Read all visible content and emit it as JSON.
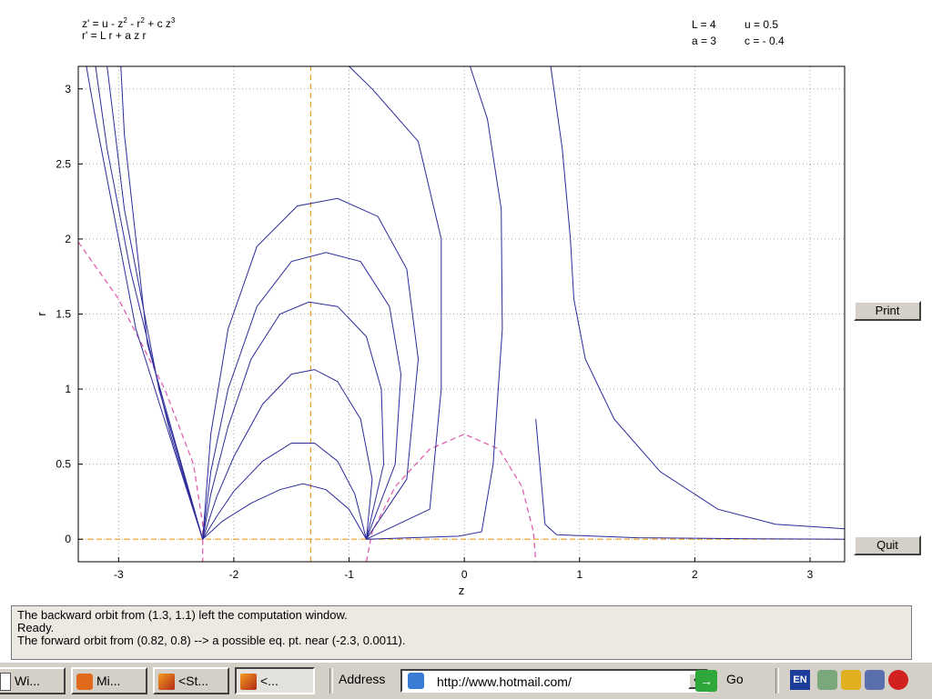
{
  "equations": {
    "z_prefix": "z' = u - z",
    "z_mid": " - r",
    "z_suffix": " + c z",
    "sup_two_a": "2",
    "sup_two_b": "2",
    "sup_three": "3",
    "r_eq": "r' = L r + a z r"
  },
  "params": {
    "L": "L = 4",
    "u": "u = 0.5",
    "a": "a = 3",
    "c": "c = - 0.4"
  },
  "buttons": {
    "print": "Print",
    "quit": "Quit"
  },
  "status_lines": [
    "The backward orbit from (1.3, 1.1) left the computation window.",
    "Ready.",
    "The forward orbit from (0.82, 0.8) --> a possible eq. pt. near (-2.3, 0.0011)."
  ],
  "taskbar": {
    "tasks": [
      "Wi...",
      "Mi...",
      "<St...",
      "<..."
    ],
    "address_label": "Address",
    "address_value": "http://www.hotmail.com/",
    "go_label": "Go",
    "lang_badge": "EN"
  },
  "colors": {
    "orbit": "#2b2b9a",
    "nullcline_z": "#e060b0",
    "nullcline_r": "#f0a020",
    "grid": "#a0a0a0"
  },
  "chart_data": {
    "type": "line",
    "xlabel": "z",
    "ylabel": "r",
    "xlim": [
      -3.35,
      3.3
    ],
    "ylim": [
      -0.15,
      3.15
    ],
    "x_ticks": [
      -3,
      -2,
      -1,
      0,
      1,
      2,
      3
    ],
    "y_ticks": [
      0,
      0.5,
      1,
      1.5,
      2,
      2.5,
      3
    ],
    "x_tick_labels": [
      "-3",
      "-2",
      "-1",
      "0",
      "1",
      "2",
      "3"
    ],
    "y_tick_labels": [
      "0",
      "0.5",
      "1",
      "1.5",
      "2",
      "2.5",
      "3"
    ],
    "grid": true,
    "orbits": [
      [
        [
          -0.85,
          0
        ],
        [
          -1.0,
          0.2
        ],
        [
          -1.2,
          0.33
        ],
        [
          -1.4,
          0.37
        ],
        [
          -1.6,
          0.33
        ],
        [
          -1.85,
          0.24
        ],
        [
          -2.1,
          0.12
        ],
        [
          -2.27,
          0
        ]
      ],
      [
        [
          -0.85,
          0
        ],
        [
          -0.95,
          0.3
        ],
        [
          -1.1,
          0.52
        ],
        [
          -1.3,
          0.64
        ],
        [
          -1.5,
          0.64
        ],
        [
          -1.75,
          0.52
        ],
        [
          -2.0,
          0.32
        ],
        [
          -2.15,
          0.15
        ],
        [
          -2.27,
          0
        ]
      ],
      [
        [
          -0.85,
          0
        ],
        [
          -0.8,
          0.4
        ],
        [
          -0.9,
          0.8
        ],
        [
          -1.1,
          1.05
        ],
        [
          -1.3,
          1.13
        ],
        [
          -1.5,
          1.1
        ],
        [
          -1.75,
          0.9
        ],
        [
          -2.0,
          0.55
        ],
        [
          -2.15,
          0.28
        ],
        [
          -2.27,
          0
        ]
      ],
      [
        [
          -0.85,
          0
        ],
        [
          -0.7,
          0.5
        ],
        [
          -0.72,
          1.0
        ],
        [
          -0.85,
          1.35
        ],
        [
          -1.1,
          1.55
        ],
        [
          -1.35,
          1.58
        ],
        [
          -1.6,
          1.5
        ],
        [
          -1.85,
          1.2
        ],
        [
          -2.05,
          0.75
        ],
        [
          -2.2,
          0.3
        ],
        [
          -2.27,
          0
        ]
      ],
      [
        [
          -0.85,
          0
        ],
        [
          -0.6,
          0.5
        ],
        [
          -0.55,
          1.1
        ],
        [
          -0.65,
          1.55
        ],
        [
          -0.9,
          1.85
        ],
        [
          -1.2,
          1.91
        ],
        [
          -1.5,
          1.85
        ],
        [
          -1.8,
          1.55
        ],
        [
          -2.05,
          1.0
        ],
        [
          -2.2,
          0.45
        ],
        [
          -2.27,
          0
        ]
      ],
      [
        [
          -0.85,
          0
        ],
        [
          -0.5,
          0.4
        ],
        [
          -0.4,
          1.2
        ],
        [
          -0.5,
          1.8
        ],
        [
          -0.75,
          2.15
        ],
        [
          -1.1,
          2.27
        ],
        [
          -1.45,
          2.22
        ],
        [
          -1.8,
          1.95
        ],
        [
          -2.05,
          1.4
        ],
        [
          -2.2,
          0.7
        ],
        [
          -2.27,
          0
        ]
      ],
      [
        [
          -0.85,
          0
        ],
        [
          -0.3,
          0.2
        ],
        [
          -0.2,
          1.0
        ],
        [
          -0.2,
          2.0
        ],
        [
          -0.4,
          2.65
        ],
        [
          -0.8,
          3.0
        ],
        [
          -1.0,
          3.15
        ]
      ],
      [
        [
          -0.85,
          0
        ],
        [
          -0.05,
          0.02
        ],
        [
          0.15,
          0.05
        ],
        [
          0.25,
          0.5
        ],
        [
          0.33,
          1.4
        ],
        [
          0.32,
          2.2
        ],
        [
          0.2,
          2.8
        ],
        [
          0.05,
          3.15
        ]
      ],
      [
        [
          0.75,
          3.15
        ],
        [
          0.85,
          2.6
        ],
        [
          0.92,
          2.0
        ],
        [
          0.95,
          1.6
        ],
        [
          1.05,
          1.2
        ],
        [
          1.3,
          0.8
        ],
        [
          1.7,
          0.45
        ],
        [
          2.2,
          0.2
        ],
        [
          2.7,
          0.1
        ],
        [
          3.3,
          0.07
        ]
      ],
      [
        [
          0.62,
          0.8
        ],
        [
          0.7,
          0.1
        ],
        [
          0.8,
          0.03
        ],
        [
          1.5,
          0.01
        ],
        [
          2.5,
          0.003
        ],
        [
          3.3,
          0.0
        ]
      ],
      [
        [
          -2.27,
          0
        ],
        [
          -2.5,
          0.55
        ],
        [
          -2.85,
          1.4
        ],
        [
          -3.05,
          2.2
        ],
        [
          -3.2,
          2.8
        ],
        [
          -3.28,
          3.15
        ]
      ],
      [
        [
          -2.27,
          0
        ],
        [
          -2.55,
          0.7
        ],
        [
          -2.9,
          1.8
        ],
        [
          -3.1,
          2.6
        ],
        [
          -3.2,
          3.15
        ]
      ],
      [
        [
          -2.27,
          0
        ],
        [
          -2.65,
          1.0
        ],
        [
          -2.95,
          2.2
        ],
        [
          -3.1,
          3.15
        ]
      ],
      [
        [
          -2.27,
          0
        ],
        [
          -2.75,
          1.3
        ],
        [
          -2.95,
          2.7
        ],
        [
          -2.98,
          3.15
        ]
      ]
    ],
    "z_nullcline_curves": [
      [
        [
          -3.35,
          1.98
        ],
        [
          -3.0,
          1.6
        ],
        [
          -2.6,
          1.0
        ],
        [
          -2.35,
          0.5
        ],
        [
          -2.27,
          0.1
        ],
        [
          -2.27,
          -0.15
        ]
      ],
      [
        [
          -0.85,
          -0.15
        ],
        [
          -0.8,
          0.05
        ],
        [
          -0.6,
          0.35
        ],
        [
          -0.3,
          0.6
        ],
        [
          0.0,
          0.7
        ],
        [
          0.3,
          0.6
        ],
        [
          0.5,
          0.35
        ],
        [
          0.6,
          0.05
        ],
        [
          0.62,
          -0.15
        ]
      ]
    ],
    "r_nullcline_curves": [
      [
        [
          -1.333,
          -0.15
        ],
        [
          -1.333,
          3.15
        ]
      ],
      [
        [
          -3.35,
          0
        ],
        [
          3.3,
          0
        ]
      ]
    ]
  }
}
